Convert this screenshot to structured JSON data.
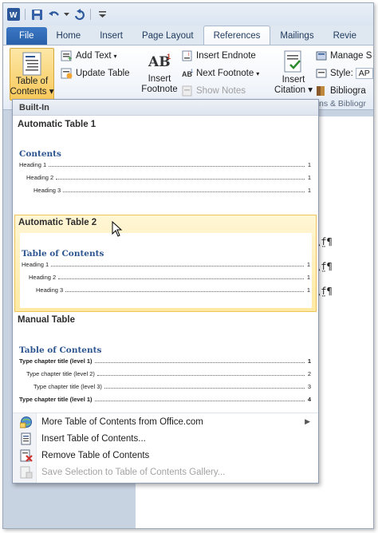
{
  "quick_access": {
    "app_icon": "word-icon",
    "icons": [
      "save-icon",
      "undo-icon",
      "redo-icon",
      "customize-icon"
    ]
  },
  "tabs": [
    {
      "label": "File"
    },
    {
      "label": "Home"
    },
    {
      "label": "Insert"
    },
    {
      "label": "Page Layout"
    },
    {
      "label": "References"
    },
    {
      "label": "Mailings"
    },
    {
      "label": "Revie"
    }
  ],
  "active_tab": "References",
  "ribbon": {
    "toc_button": {
      "line1": "Table of",
      "line2": "Contents"
    },
    "add_text": "Add Text",
    "update_table": "Update Table",
    "insert_footnote": {
      "line1": "Insert",
      "line2": "Footnote"
    },
    "insert_endnote": "Insert Endnote",
    "next_footnote": "Next Footnote",
    "show_notes": "Show Notes",
    "insert_citation": {
      "line1": "Insert",
      "line2": "Citation"
    },
    "manage_sources": "Manage S",
    "style_label": "Style:",
    "style_value": "AP",
    "bibliography": "Bibliogra",
    "group_label_citations": "ns & Bibliogr"
  },
  "document": {
    "field_codes": [
      "\\f̤¶",
      "\\f̤¶",
      "\\f̤¶"
    ]
  },
  "gallery": {
    "header": "Built-In",
    "items": [
      {
        "title": "Automatic Table 1",
        "preview_title": "Contents",
        "rows": [
          {
            "label": "Heading 1",
            "num": "1"
          },
          {
            "label": "Heading 2",
            "num": "1"
          },
          {
            "label": "Heading 3",
            "num": "1"
          }
        ]
      },
      {
        "title": "Automatic Table 2",
        "preview_title": "Table of Contents",
        "rows": [
          {
            "label": "Heading 1",
            "num": "1"
          },
          {
            "label": "Heading 2",
            "num": "1"
          },
          {
            "label": "Heading 3",
            "num": "1"
          }
        ]
      },
      {
        "title": "Manual Table",
        "preview_title": "Table of Contents",
        "rows": [
          {
            "label": "Type chapter title (level 1)",
            "num": "1"
          },
          {
            "label": "Type chapter title (level 2)",
            "num": "2"
          },
          {
            "label": "Type chapter title (level 3)",
            "num": "3"
          },
          {
            "label": "Type chapter title (level 1)",
            "num": "4"
          }
        ]
      }
    ],
    "menu": [
      {
        "label": "More Table of Contents from Office.com",
        "icon": "globe-icon"
      },
      {
        "label": "Insert Table of Contents...",
        "icon": "document-icon"
      },
      {
        "label": "Remove Table of Contents",
        "icon": "remove-icon"
      },
      {
        "label": "Save Selection to Table of Contents Gallery...",
        "icon": "save-selection-icon"
      }
    ]
  },
  "colors": {
    "accent": "#2b579a",
    "hover_fill": "#ffe9a3",
    "toc_heading": "#2d5590"
  }
}
